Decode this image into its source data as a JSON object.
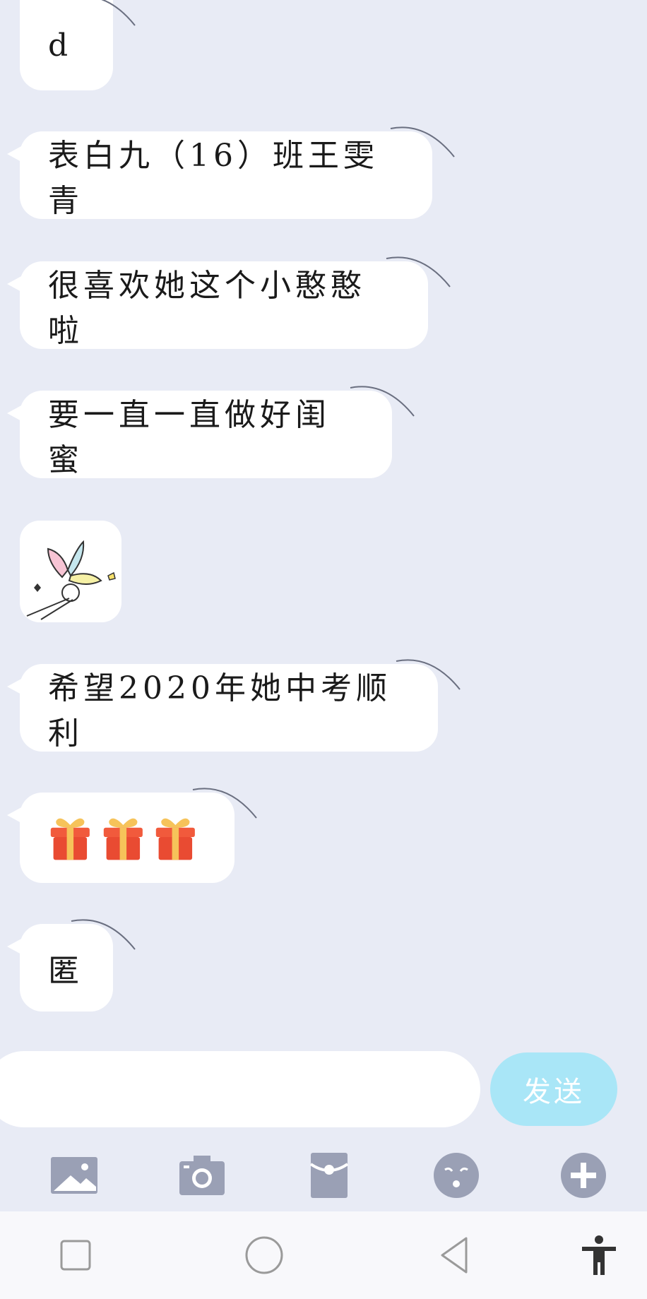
{
  "messages": [
    {
      "text": "d"
    },
    {
      "text": "表白九（16）班王雯青"
    },
    {
      "text": "很喜欢她这个小憨憨啦"
    },
    {
      "text": "要一直一直做好闺蜜"
    },
    {
      "sticker": "windmill-sticker"
    },
    {
      "text": "希望2020年她中考顺利"
    },
    {
      "emoji": [
        "gift-icon",
        "gift-icon",
        "gift-icon"
      ]
    },
    {
      "text": "匿"
    }
  ],
  "composer": {
    "value": "",
    "send_label": "发送"
  },
  "toolbar": {
    "items": [
      "image-icon",
      "camera-icon",
      "red-packet-icon",
      "emoji-icon",
      "plus-icon"
    ]
  },
  "system_nav": {
    "items": [
      "recent-apps-icon",
      "home-icon",
      "back-icon",
      "accessibility-icon"
    ]
  },
  "colors": {
    "background": "#e8ebf5",
    "bubble": "#ffffff",
    "send_button": "#a9e6f7",
    "toolbar_icon": "#9aa0b5"
  }
}
